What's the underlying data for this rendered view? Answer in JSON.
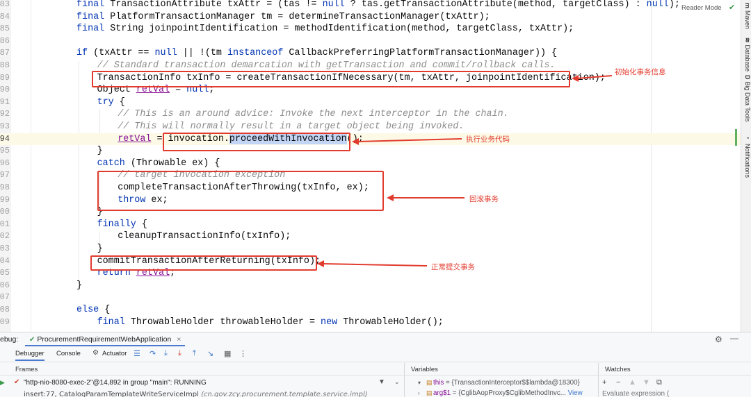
{
  "editor": {
    "reader_mode": "Reader Mode",
    "lines": [
      {
        "n": "83",
        "indent": 0,
        "parts": [
          [
            "kw",
            "final "
          ],
          [
            "t",
            "TransactionAttribute txAttr = (tas != "
          ],
          [
            "kw",
            "null"
          ],
          [
            "t",
            " ? tas.getTransactionAttribute(method, targetClass) : "
          ],
          [
            "kw",
            "null"
          ],
          [
            "t",
            ");"
          ]
        ]
      },
      {
        "n": "84",
        "indent": 0,
        "parts": [
          [
            "kw",
            "final "
          ],
          [
            "t",
            "PlatformTransactionManager tm = determineTransactionManager(txAttr);"
          ]
        ]
      },
      {
        "n": "85",
        "indent": 0,
        "parts": [
          [
            "kw",
            "final "
          ],
          [
            "t",
            "String joinpointIdentification = methodIdentification(method, targetClass, txAttr);"
          ]
        ]
      },
      {
        "n": "86",
        "indent": 0,
        "parts": []
      },
      {
        "n": "87",
        "indent": 0,
        "parts": [
          [
            "kw",
            "if "
          ],
          [
            "t",
            "(txAttr == "
          ],
          [
            "kw",
            "null"
          ],
          [
            "t",
            " || !(tm "
          ],
          [
            "kw",
            "instanceof "
          ],
          [
            "t",
            "CallbackPreferringPlatformTransactionManager)) {"
          ]
        ]
      },
      {
        "n": "88",
        "indent": 1,
        "parts": [
          [
            "cm",
            "// Standard transaction demarcation with getTransaction and commit/rollback calls."
          ]
        ]
      },
      {
        "n": "89",
        "indent": 1,
        "parts": [
          [
            "t",
            "TransactionInfo txInfo = createTransactionIfNecessary(tm, txAttr, joinpointIdentification);"
          ]
        ]
      },
      {
        "n": "90",
        "indent": 1,
        "parts": [
          [
            "t",
            "Object "
          ],
          [
            "var",
            "retVal"
          ],
          [
            "t",
            " = "
          ],
          [
            "kw",
            "null"
          ],
          [
            "t",
            ";"
          ]
        ]
      },
      {
        "n": "91",
        "indent": 1,
        "parts": [
          [
            "kw",
            "try "
          ],
          [
            "t",
            "{"
          ]
        ]
      },
      {
        "n": "92",
        "indent": 2,
        "parts": [
          [
            "cm",
            "// This is an around advice: Invoke the next interceptor in the chain."
          ]
        ]
      },
      {
        "n": "93",
        "indent": 2,
        "parts": [
          [
            "cm",
            "// This will normally result in a target object being invoked."
          ]
        ]
      },
      {
        "n": "94",
        "indent": 2,
        "current": true,
        "parts": [
          [
            "var",
            "retVal"
          ],
          [
            "t",
            " = invocation."
          ],
          [
            "hl",
            "proceedWithInvocation"
          ],
          [
            "t",
            "();"
          ]
        ]
      },
      {
        "n": "95",
        "indent": 1,
        "parts": [
          [
            "t",
            "}"
          ]
        ]
      },
      {
        "n": "96",
        "indent": 1,
        "parts": [
          [
            "kw",
            "catch "
          ],
          [
            "t",
            "(Throwable ex) {"
          ]
        ]
      },
      {
        "n": "97",
        "indent": 2,
        "parts": [
          [
            "cm",
            "// target invocation exception"
          ]
        ]
      },
      {
        "n": "98",
        "indent": 2,
        "parts": [
          [
            "t",
            "completeTransactionAfterThrowing(txInfo, ex);"
          ]
        ]
      },
      {
        "n": "99",
        "indent": 2,
        "parts": [
          [
            "kw",
            "throw "
          ],
          [
            "t",
            "ex;"
          ]
        ]
      },
      {
        "n": "00",
        "indent": 1,
        "parts": [
          [
            "t",
            "}"
          ]
        ]
      },
      {
        "n": "01",
        "indent": 1,
        "parts": [
          [
            "kw",
            "finally "
          ],
          [
            "t",
            "{"
          ]
        ]
      },
      {
        "n": "02",
        "indent": 2,
        "parts": [
          [
            "t",
            "cleanupTransactionInfo(txInfo);"
          ]
        ]
      },
      {
        "n": "03",
        "indent": 1,
        "parts": [
          [
            "t",
            "}"
          ]
        ]
      },
      {
        "n": "04",
        "indent": 1,
        "parts": [
          [
            "t",
            "commitTransactionAfterReturning(txInfo);"
          ]
        ]
      },
      {
        "n": "05",
        "indent": 1,
        "parts": [
          [
            "kw",
            "return "
          ],
          [
            "var",
            "retVal"
          ],
          [
            "t",
            ";"
          ]
        ]
      },
      {
        "n": "06",
        "indent": 0,
        "parts": [
          [
            "t",
            "}"
          ]
        ]
      },
      {
        "n": "07",
        "indent": 0,
        "parts": []
      },
      {
        "n": "08",
        "indent": 0,
        "parts": [
          [
            "kw",
            "else "
          ],
          [
            "t",
            "{"
          ]
        ]
      },
      {
        "n": "09",
        "indent": 1,
        "parts": [
          [
            "kw",
            "final "
          ],
          [
            "t",
            "ThrowableHolder throwableHolder = "
          ],
          [
            "kw",
            "new "
          ],
          [
            "t",
            "ThrowableHolder();"
          ]
        ]
      }
    ]
  },
  "annotations": {
    "init_tx": "初始化事务信息",
    "exec_business": "执行业务代码",
    "rollback": "回滚事务",
    "commit": "正常提交事务"
  },
  "right_strip": {
    "maven": "Maven",
    "database": "Database",
    "big_data_tools": "Big Data Tools",
    "notifications": "Notifications"
  },
  "debug": {
    "label": "ebug:",
    "run_config": "ProcurementRequirementWebApplication",
    "tabs": {
      "debugger": "Debugger",
      "console": "Console",
      "actuator": "Actuator"
    },
    "frames": {
      "header": "Frames",
      "thread": "\"http-nio-8080-exec-2\"@14,892 in group \"main\": RUNNING",
      "frame_method": "insert:77, CatalogParamTemplateWriteServiceImpl",
      "frame_pkg": "(cn.gov.zcy.procurement.template.service.impl)"
    },
    "variables": {
      "header": "Variables",
      "rows": [
        {
          "chev": "▾",
          "name": "this",
          "value": " = {TransactionInterceptor$$lambda@18300}",
          "link": ""
        },
        {
          "chev": "›",
          "name": "arg$1",
          "value": " = {CglibAopProxy$CglibMethodInvc...",
          "link": " View"
        }
      ]
    },
    "watches": {
      "header": "Watches",
      "placeholder": "Evaluate expression ("
    }
  },
  "colors": {
    "annotation_red": "#e23b2e",
    "keyword_blue": "#0033b3",
    "comment_gray": "#8c8c8c",
    "field_purple": "#871094",
    "selection": "#c2d5f5"
  }
}
